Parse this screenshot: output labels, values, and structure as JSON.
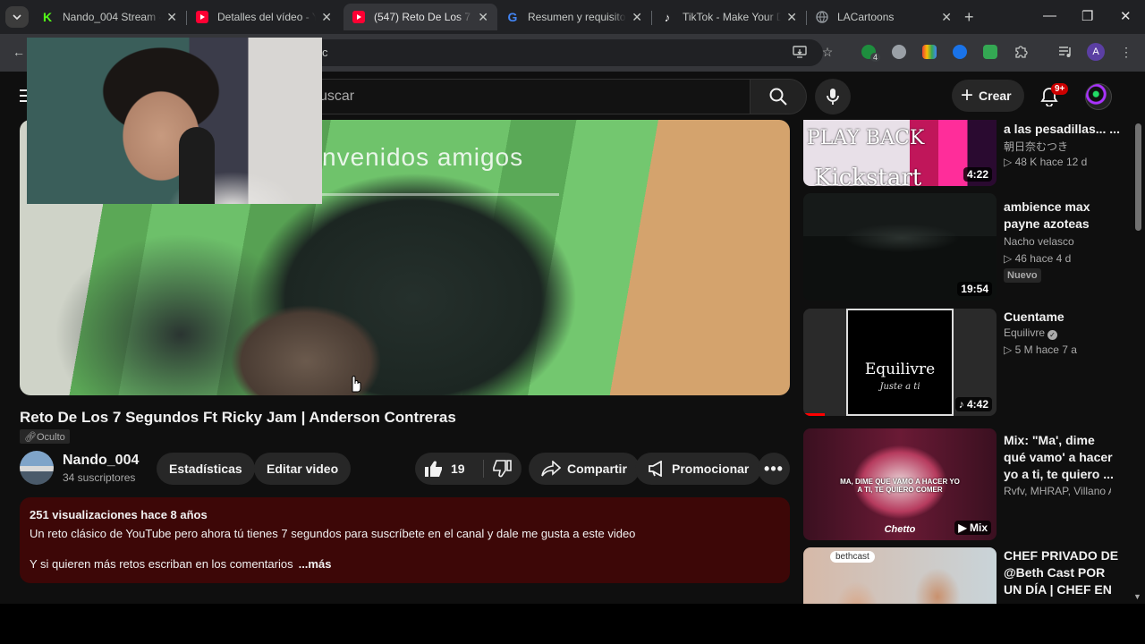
{
  "browser": {
    "tabs": [
      {
        "title": "Nando_004 Stream -",
        "icon": "kick-icon",
        "color": "#53fc18",
        "active": false
      },
      {
        "title": "Detalles del vídeo - Y",
        "icon": "youtube-studio-icon",
        "color": "#ff0033",
        "active": false
      },
      {
        "title": "(547) Reto De Los 7 S",
        "icon": "youtube-icon",
        "color": "#ff0033",
        "active": true
      },
      {
        "title": "Resumen y requisitos",
        "icon": "google-icon",
        "color": "#4285f4",
        "active": false
      },
      {
        "title": "TikTok - Make Your D",
        "icon": "tiktok-icon",
        "color": "#ffffff",
        "active": false
      },
      {
        "title": "LACartoons",
        "icon": "globe-icon",
        "color": "#9aa0a6",
        "active": false
      }
    ],
    "url_fragment": "c",
    "extension_badge": "4",
    "profile_letter": "A"
  },
  "masthead": {
    "search_placeholder": "uscar",
    "create_label": "Crear",
    "notification_badge": "9+"
  },
  "video": {
    "overlay_text": "nvenidos  amigos",
    "title": "Reto De Los 7 Segundos Ft Ricky Jam | Anderson Contreras",
    "privacy": "Oculto",
    "channel": "Nando_004",
    "subscribers": "34 suscriptores",
    "stats_label": "Estadísticas",
    "edit_label": "Editar video",
    "likes": "19",
    "share_label": "Compartir",
    "promote_label": "Promocionar",
    "description": {
      "meta": "251 visualizaciones  hace 8 años",
      "line1": "Un reto clásico de YouTube pero ahora tú tienes 7 segundos para suscríbete en el canal y dale me gusta a este video",
      "line2": "Y si quieren más retos escriban en los comentarios",
      "more": "...más"
    }
  },
  "sidebar": [
    {
      "title": "a las pesadillas... ...",
      "channel": "朝日奈むつき",
      "meta": "▷ 48 K  hace 12 d",
      "duration": "4:22",
      "thumb_text": "PLAY BACK",
      "thumb_text2": "Kickstart"
    },
    {
      "title": "ambience max payne azoteas",
      "channel": "Nacho velasco",
      "meta": "▷ 46  hace 4 d",
      "badge": "Nuevo",
      "duration": "19:54"
    },
    {
      "title": "Cuentame",
      "channel": "Equilivre",
      "meta": "▷ 5 M  hace 7 a",
      "duration": "♪ 4:42",
      "thumb_text": "Equilivre",
      "thumb_text2": "Juste a ti"
    },
    {
      "title": "Mix: \"Ma', dime qué vamo' a hacer yo a ti, te quiero ...",
      "channel": "Rvfv, MHRAP, Villano A...",
      "duration": "▶ Mix",
      "thumb_text": "MA, DIME QUE VAMO A HACER YO A TI, TE QUIERO COMER",
      "thumb_text2": "Chetto"
    },
    {
      "title": "CHEF PRIVADO DE @Beth Cast  POR UN DÍA | CHEF EN ...",
      "thumb_text": "bethcast"
    }
  ]
}
